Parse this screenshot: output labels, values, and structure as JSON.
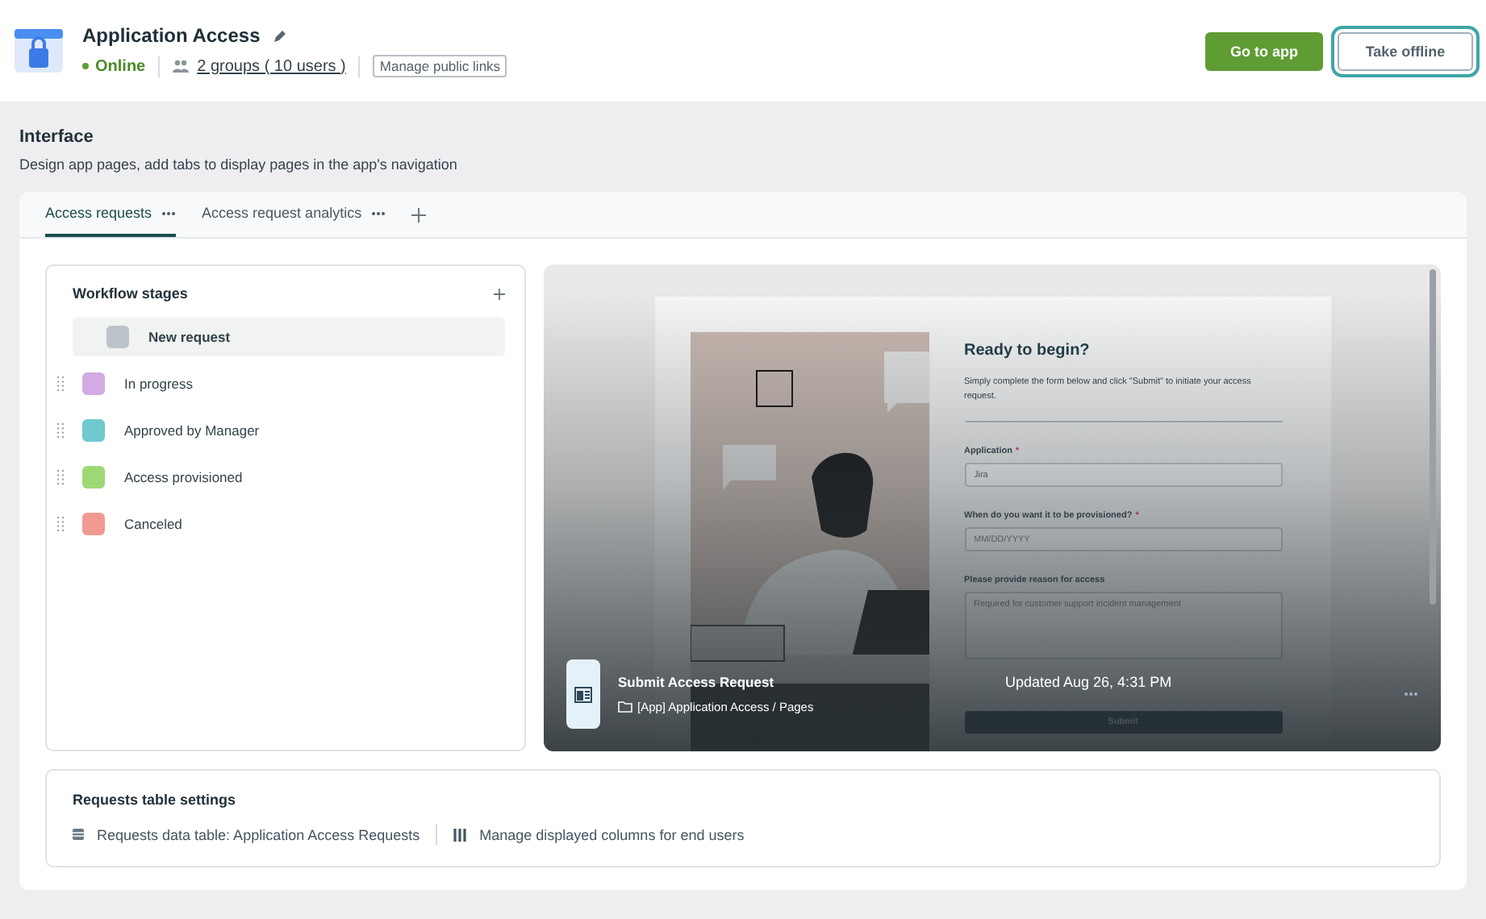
{
  "app": {
    "title": "Application Access",
    "status": "Online",
    "groups_link": "2 groups ( 10 users )",
    "public_links_button": "Manage public links"
  },
  "actions": [
    {
      "label": "Go to app",
      "kind": "primary",
      "focused": false
    },
    {
      "label": "Take offline",
      "kind": "secondary",
      "focused": true
    }
  ],
  "interface": {
    "title": "Interface",
    "description": "Design app pages, add tabs to display pages in the app's navigation"
  },
  "tabs": [
    {
      "label": "Access requests",
      "selected": true
    },
    {
      "label": "Access request analytics",
      "selected": false
    }
  ],
  "workflow": {
    "title": "Workflow stages",
    "stages": [
      {
        "name": "New request",
        "color": "#bcc3c9",
        "selected": true,
        "draggable": false
      },
      {
        "name": "In progress",
        "color": "#d4a9e4",
        "selected": false,
        "draggable": true
      },
      {
        "name": "Approved by Manager",
        "color": "#6ecacf",
        "selected": false,
        "draggable": true
      },
      {
        "name": "Access provisioned",
        "color": "#9ed874",
        "selected": false,
        "draggable": true
      },
      {
        "name": "Canceled",
        "color": "#f19a91",
        "selected": false,
        "draggable": true
      }
    ]
  },
  "preview": {
    "form": {
      "heading": "Ready to begin?",
      "intro": "Simply complete the form below and click \"Submit\" to initiate your access request.",
      "fields": [
        {
          "kind": "select",
          "label": "Application",
          "required_mark": "*",
          "value": "Jira"
        },
        {
          "kind": "date",
          "label": "When do you want it to be provisioned?",
          "required_mark": "*",
          "placeholder": "MM/DD/YYYY"
        },
        {
          "kind": "textarea",
          "label": "Please provide reason for access",
          "placeholder": "Required for customer support incident management"
        }
      ],
      "submit": "Submit"
    },
    "page": {
      "title": "Submit Access Request",
      "path": "[App] Application Access / Pages",
      "updated": "Updated Aug 26, 4:31 PM"
    }
  },
  "table_settings": {
    "title": "Requests table settings",
    "links": [
      {
        "kind": "table",
        "label": "Requests data table: Application Access Requests"
      },
      {
        "kind": "columns",
        "label": "Manage displayed columns for end users"
      }
    ]
  }
}
